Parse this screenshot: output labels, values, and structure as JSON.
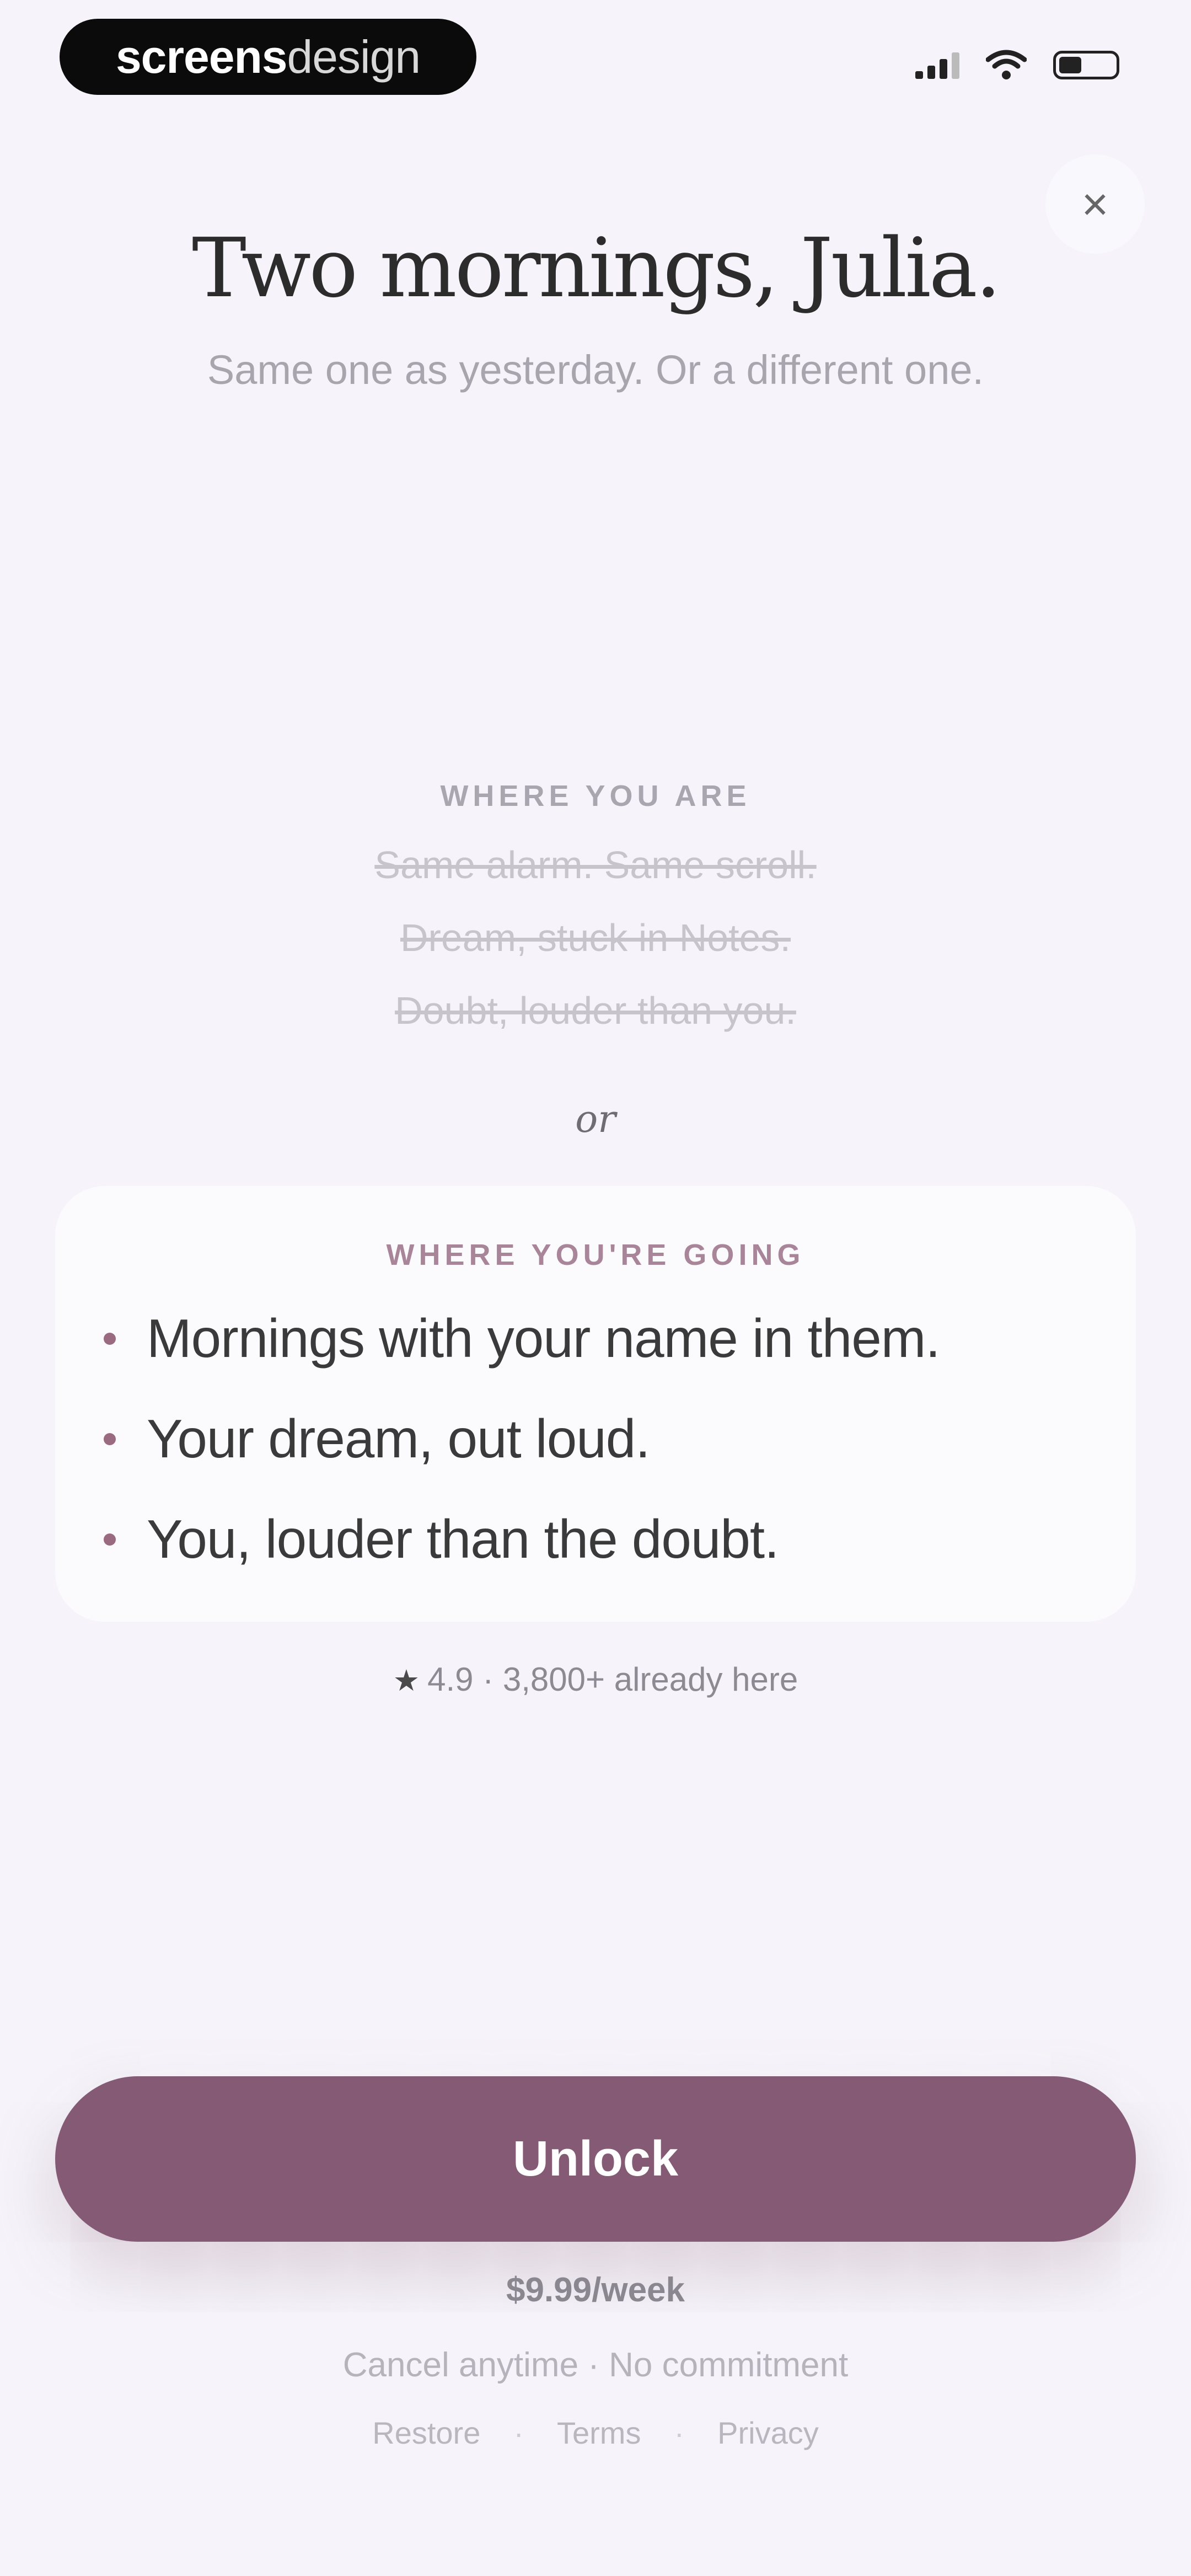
{
  "status_bar": {
    "badge_bold": "screens",
    "badge_light": "design"
  },
  "close_icon": "×",
  "header": {
    "title": "Two mornings, Julia.",
    "subtitle": "Same one as yesterday. Or a different one."
  },
  "past": {
    "label": "WHERE YOU ARE",
    "lines": [
      "Same alarm. Same scroll.",
      "Dream, stuck in Notes.",
      "Doubt, louder than you."
    ]
  },
  "divider": "or",
  "future": {
    "label": "WHERE YOU'RE GOING",
    "items": [
      "Mornings with your name in them.",
      "Your dream, out loud.",
      "You, louder than the doubt."
    ]
  },
  "rating": {
    "star": "★",
    "text": "4.9 · 3,800+ already here"
  },
  "cta": {
    "label": "Unlock",
    "price": "$9.99/week",
    "note": "Cancel anytime · No commitment"
  },
  "footer": {
    "restore": "Restore",
    "terms": "Terms",
    "privacy": "Privacy",
    "separator": "·"
  },
  "colors": {
    "accent": "#845a74",
    "background": "#f6f4fa"
  },
  "icons": [
    "signal-icon",
    "wifi-icon",
    "battery-icon",
    "close-icon",
    "star-icon",
    "bullet-icon"
  ]
}
